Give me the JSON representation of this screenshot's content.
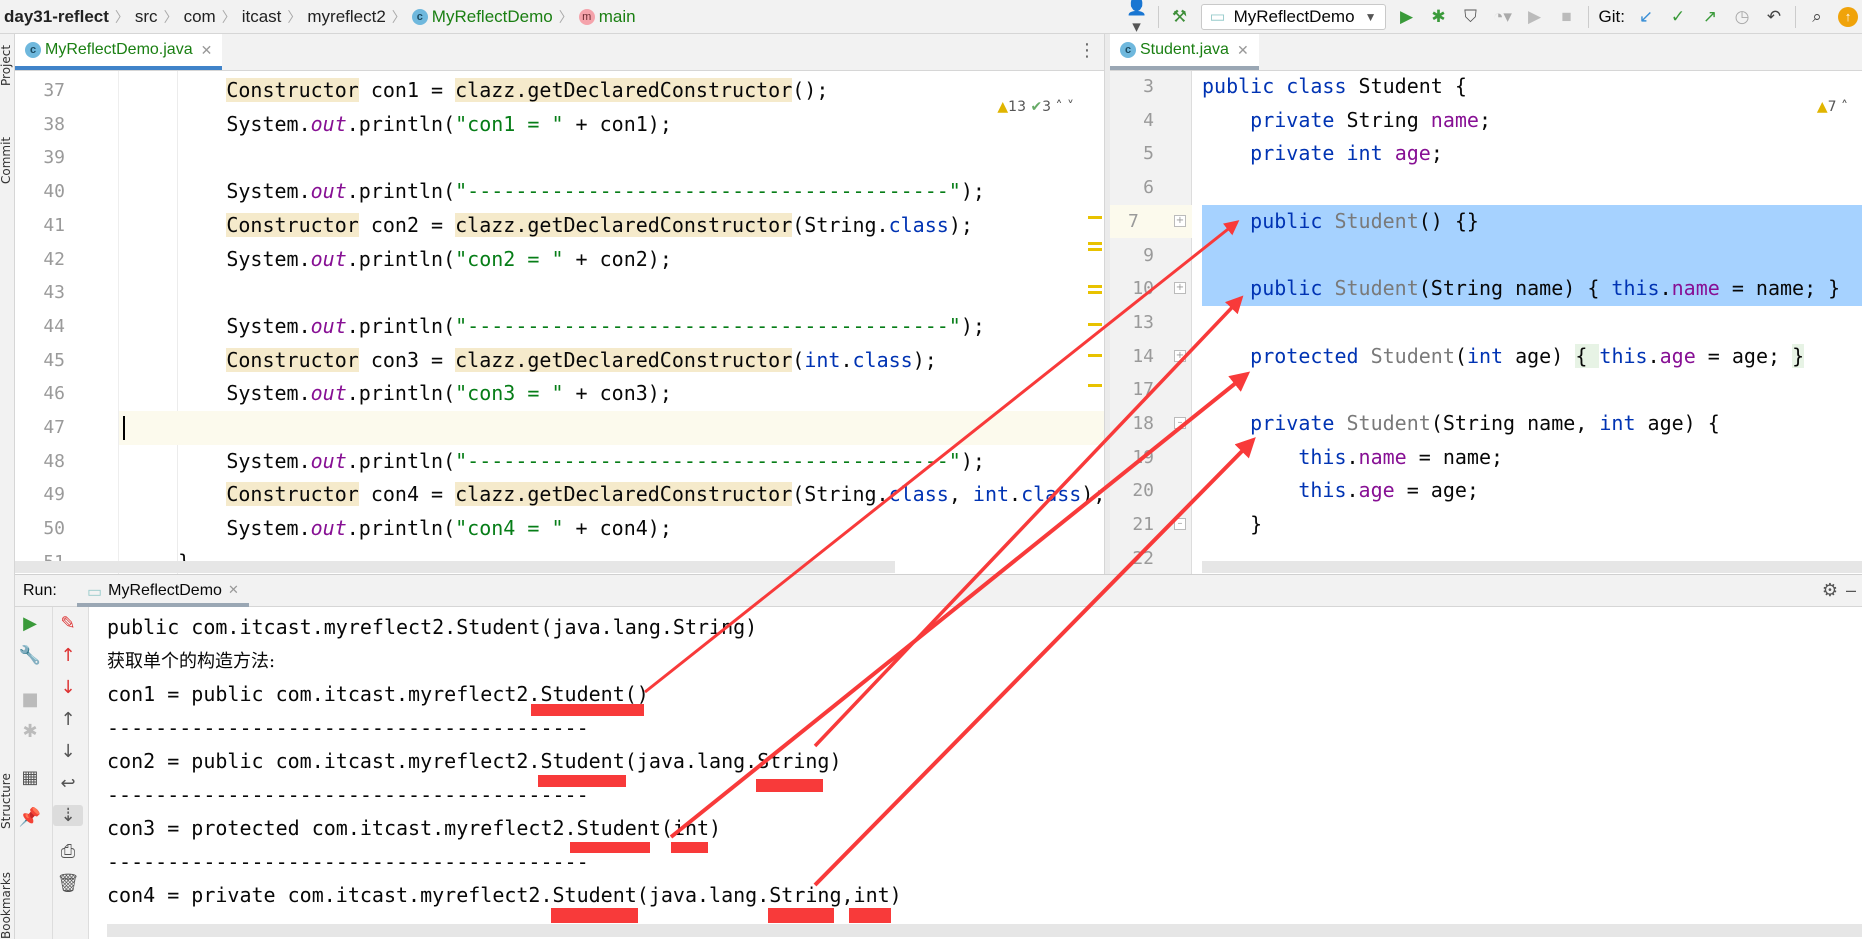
{
  "breadcrumb": [
    "day31-reflect",
    "src",
    "com",
    "itcast",
    "myreflect2",
    "MyReflectDemo",
    "main"
  ],
  "toolbar": {
    "run_config": "MyReflectDemo",
    "git_label": "Git:",
    "icons": [
      "user-icon",
      "build-hammer-icon",
      "run-icon",
      "debug-icon",
      "coverage-icon",
      "profile-icon",
      "resume-icon",
      "stop-icon",
      "git-update-icon",
      "git-commit-icon",
      "git-push-icon",
      "history-icon",
      "revert-icon",
      "search-icon",
      "update-icon"
    ]
  },
  "sidebar": {
    "top": [
      "Project",
      "Commit"
    ],
    "bottom": [
      "Structure",
      "Bookmarks"
    ]
  },
  "left_editor": {
    "tab": "MyReflectDemo.java",
    "inspections": {
      "warnings": "13",
      "typos": "3"
    },
    "first_line": 37,
    "current_line": 47,
    "lines": [
      [
        [
          "        "
        ],
        [
          "Constructor",
          "u"
        ],
        [
          " con1 = "
        ],
        [
          "clazz.getDeclaredConstructor",
          "u"
        ],
        [
          "();"
        ]
      ],
      [
        [
          "        System."
        ],
        [
          "out",
          "fi"
        ],
        [
          ".println("
        ],
        [
          "\"con1 = \"",
          "s"
        ],
        [
          " + con1);"
        ]
      ],
      [],
      [
        [
          "        System."
        ],
        [
          "out",
          "fi"
        ],
        [
          ".println("
        ],
        [
          "\"----------------------------------------\"",
          "s"
        ],
        [
          ");"
        ]
      ],
      [
        [
          "        "
        ],
        [
          "Constructor",
          "u"
        ],
        [
          " con2 = "
        ],
        [
          "clazz.getDeclaredConstructor",
          "u"
        ],
        [
          "(String."
        ],
        [
          "class",
          "k"
        ],
        [
          ");"
        ]
      ],
      [
        [
          "        System."
        ],
        [
          "out",
          "fi"
        ],
        [
          ".println("
        ],
        [
          "\"con2 = \"",
          "s"
        ],
        [
          " + con2);"
        ]
      ],
      [],
      [
        [
          "        System."
        ],
        [
          "out",
          "fi"
        ],
        [
          ".println("
        ],
        [
          "\"----------------------------------------\"",
          "s"
        ],
        [
          ");"
        ]
      ],
      [
        [
          "        "
        ],
        [
          "Constructor",
          "u"
        ],
        [
          " con3 = "
        ],
        [
          "clazz.getDeclaredConstructor",
          "u"
        ],
        [
          "("
        ],
        [
          "int",
          "k"
        ],
        [
          "."
        ],
        [
          "class",
          "k"
        ],
        [
          ");"
        ]
      ],
      [
        [
          "        System."
        ],
        [
          "out",
          "fi"
        ],
        [
          ".println("
        ],
        [
          "\"con3 = \"",
          "s"
        ],
        [
          " + con3);"
        ]
      ],
      [],
      [
        [
          "        System."
        ],
        [
          "out",
          "fi"
        ],
        [
          ".println("
        ],
        [
          "\"----------------------------------------\"",
          "s"
        ],
        [
          ");"
        ]
      ],
      [
        [
          "        "
        ],
        [
          "Constructor",
          "u"
        ],
        [
          " con4 = "
        ],
        [
          "clazz.getDeclaredConstructor",
          "u"
        ],
        [
          "(String."
        ],
        [
          "class",
          "k"
        ],
        [
          ", "
        ],
        [
          "int",
          "k"
        ],
        [
          "."
        ],
        [
          "class",
          "k"
        ],
        [
          ");"
        ]
      ],
      [
        [
          "        System."
        ],
        [
          "out",
          "fi"
        ],
        [
          ".println("
        ],
        [
          "\"con4 = \"",
          "s"
        ],
        [
          " + con4);"
        ]
      ],
      [
        [
          "    }"
        ]
      ]
    ]
  },
  "right_editor": {
    "tab": "Student.java",
    "inspections": {
      "warnings": "7"
    },
    "line_numbers": [
      3,
      4,
      5,
      6,
      7,
      9,
      10,
      13,
      14,
      17,
      18,
      19,
      20,
      21,
      22
    ],
    "selected_lines": [
      7,
      10
    ],
    "lines": [
      [
        [
          "public",
          "k"
        ],
        [
          " "
        ],
        [
          "class",
          "k"
        ],
        [
          " Student {"
        ]
      ],
      [
        [
          "    "
        ],
        [
          "private",
          "k"
        ],
        [
          " String "
        ],
        [
          "name",
          "f"
        ],
        [
          ";"
        ]
      ],
      [
        [
          "    "
        ],
        [
          "private",
          "k"
        ],
        [
          " "
        ],
        [
          "int",
          "k"
        ],
        [
          " "
        ],
        [
          "age",
          "f"
        ],
        [
          ";"
        ]
      ],
      [],
      [
        [
          "    "
        ],
        [
          "public",
          "k"
        ],
        [
          " "
        ],
        [
          "Student",
          "g"
        ],
        [
          "() {}"
        ]
      ],
      [],
      [
        [
          "    "
        ],
        [
          "public",
          "k"
        ],
        [
          " "
        ],
        [
          "Student",
          "g"
        ],
        [
          "(String name) { "
        ],
        [
          "this",
          "k"
        ],
        [
          "."
        ],
        [
          "name",
          "f"
        ],
        [
          " = name; }"
        ]
      ],
      [],
      [
        [
          "    "
        ],
        [
          "protected",
          "k"
        ],
        [
          " "
        ],
        [
          "Student",
          "g"
        ],
        [
          "("
        ],
        [
          "int",
          "k"
        ],
        [
          " age) "
        ],
        [
          "{ ",
          "pg"
        ],
        [
          "this",
          "k"
        ],
        [
          "."
        ],
        [
          "age",
          "f"
        ],
        [
          " = age; "
        ],
        [
          "}",
          "pg"
        ]
      ],
      [],
      [
        [
          "    "
        ],
        [
          "private",
          "k"
        ],
        [
          " "
        ],
        [
          "Student",
          "g"
        ],
        [
          "(String name, "
        ],
        [
          "int",
          "k"
        ],
        [
          " age) {"
        ]
      ],
      [
        [
          "        "
        ],
        [
          "this",
          "k"
        ],
        [
          "."
        ],
        [
          "name",
          "f"
        ],
        [
          " = name;"
        ]
      ],
      [
        [
          "        "
        ],
        [
          "this",
          "k"
        ],
        [
          "."
        ],
        [
          "age",
          "f"
        ],
        [
          " = age;"
        ]
      ],
      [
        [
          "    }"
        ]
      ],
      []
    ]
  },
  "run": {
    "label": "Run:",
    "tab": "MyReflectDemo",
    "output": [
      "public com.itcast.myreflect2.Student(java.lang.String)",
      "获取单个的构造方法:",
      "con1 = public com.itcast.myreflect2.Student()",
      "----------------------------------------",
      "con2 = public com.itcast.myreflect2.Student(java.lang.String)",
      "----------------------------------------",
      "con3 = protected com.itcast.myreflect2.Student(int)",
      "----------------------------------------",
      "con4 = private com.itcast.myreflect2.Student(java.lang.String,int)"
    ]
  },
  "colors": {
    "annotation_red": "#f83a3a",
    "selection": "#a6d2ff",
    "keyword": "#0033b3",
    "string": "#067d17",
    "field": "#871094",
    "usage_highlight": "#f5eacb"
  }
}
